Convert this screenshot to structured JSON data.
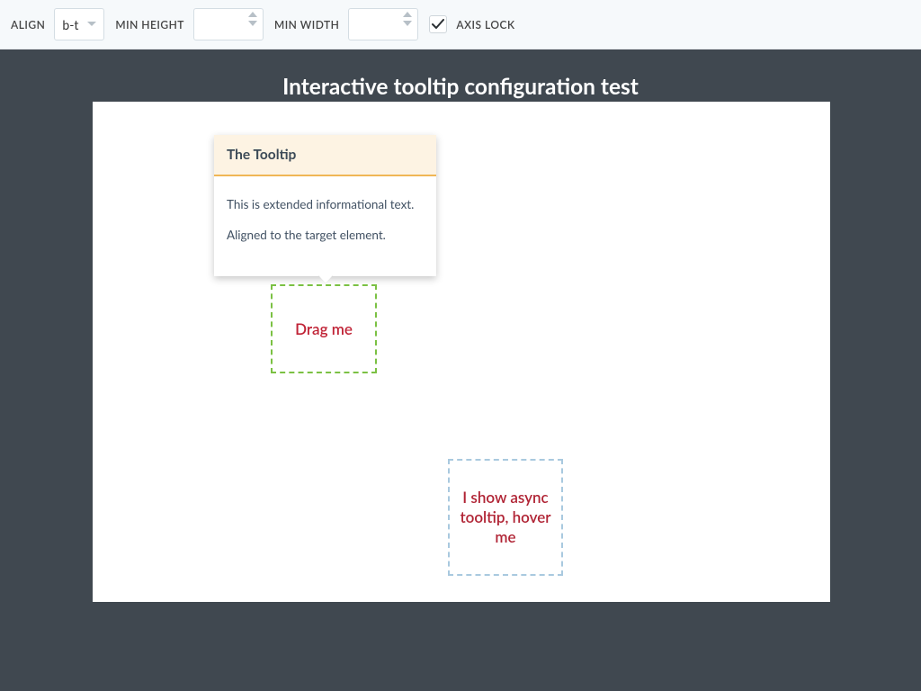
{
  "toolbar": {
    "align_label": "ALIGN",
    "align_value": "b-t",
    "min_height_label": "MIN HEIGHT",
    "min_height_value": "",
    "min_width_label": "MIN WIDTH",
    "min_width_value": "",
    "axis_lock_label": "AXIS LOCK",
    "axis_lock_checked": true
  },
  "page_title": "Interactive tooltip configuration test",
  "tooltip": {
    "title": "The Tooltip",
    "line1": "This is extended informational text.",
    "line2": "Aligned to the target element."
  },
  "drag_target": "Drag me",
  "async_target": "I show async tooltip, hover me"
}
